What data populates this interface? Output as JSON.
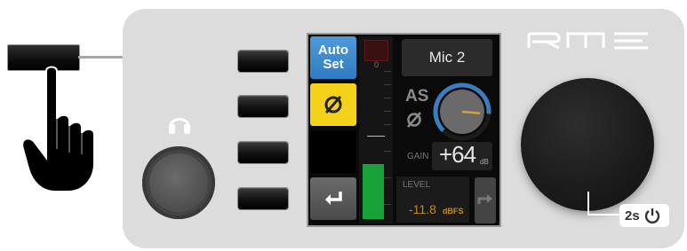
{
  "device": {
    "brand_logo": "RME",
    "input_name": "Mic 2",
    "meter_zero_label": "0",
    "softkeys": {
      "autoset_label_line1": "Auto",
      "autoset_label_line2": "Set",
      "phase_icon": "phase-invert-icon",
      "return_icon": "return-arrow-icon"
    },
    "status": {
      "autoset_indicator": "AS",
      "phase_indicator": "phase-invert-icon"
    },
    "gain": {
      "label": "GAIN",
      "value": "+64",
      "unit": "dB",
      "knob_fraction": 0.85
    },
    "level": {
      "label": "LEVEL",
      "value": "-11.8",
      "unit": "dBFS"
    },
    "level_meter_fraction": 0.31,
    "power_hint": {
      "hold_time": "2s",
      "icon": "power-icon"
    },
    "colors": {
      "autoset_blue": "#2f7cc4",
      "phase_yellow": "#f5d21a",
      "meter_green": "#1aa23a",
      "level_orange": "#c78b1e",
      "knob_accent": "#d4a13a"
    }
  }
}
